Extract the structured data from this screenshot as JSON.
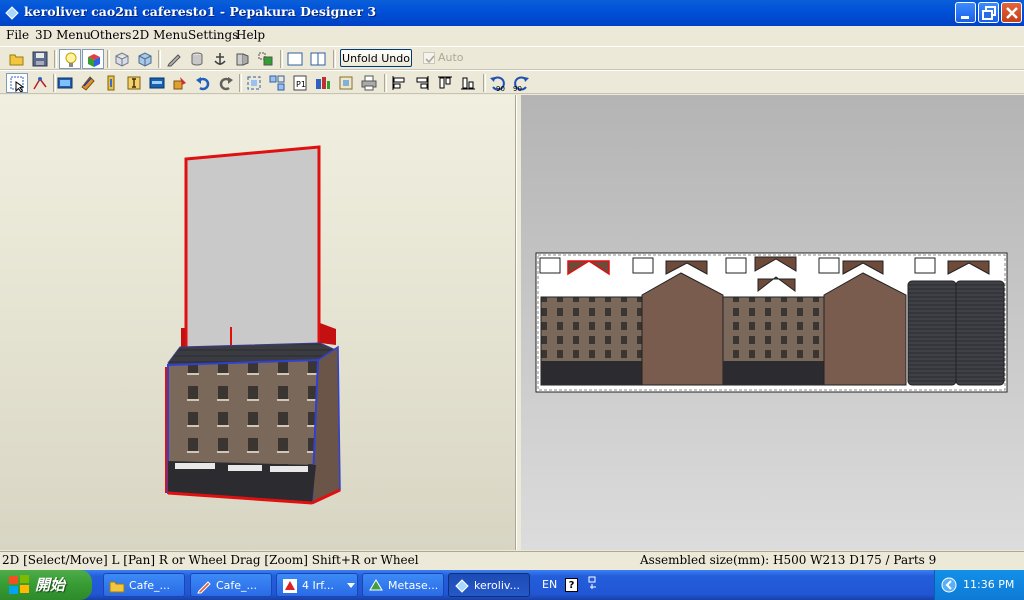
{
  "window": {
    "title": "keroliver cao2ni caferesto1 - Pepakura Designer 3",
    "controls": [
      "minimize-icon",
      "restore-icon",
      "close-icon"
    ]
  },
  "menu": [
    "File",
    "3D Menu",
    "Others",
    "2D Menu",
    "Settings",
    "Help"
  ],
  "toolbar1": {
    "icons": [
      "open-folder-icon",
      "save-icon",
      "lightbulb-icon",
      "color-cube-icon",
      "cube-icon",
      "textured-cube-icon",
      "pencil-icon",
      "cylinder-icon",
      "anchor-icon",
      "flap-icon",
      "join-icon",
      "single-view-icon",
      "dual-view-icon"
    ],
    "unfold_undo_label": "Unfold Undo",
    "auto_label": "Auto"
  },
  "toolbar2": {
    "icons": [
      "select-move-icon",
      "edit-edges-icon",
      "film-icon",
      "join-faces-icon",
      "flap-toggle-icon",
      "text-icon",
      "image-icon",
      "rotate-part-icon",
      "undo-arrow-icon",
      "redo-arrow-icon",
      "fit-view-icon",
      "arrange-icon",
      "page-icon",
      "layout-icon",
      "texture-icon",
      "print-icon",
      "align-left-icon",
      "align-right-icon",
      "align-top-icon",
      "align-bottom-icon",
      "rotate-ccw-90-icon",
      "rotate-cw-90-icon"
    ],
    "rotate_labels": [
      "90",
      "90"
    ]
  },
  "status": {
    "left": "2D [Select/Move] L [Pan] R or Wheel Drag [Zoom] Shift+R or Wheel",
    "right": "Assembled size(mm): H500  W213  D175 / Parts 9"
  },
  "taskbar": {
    "start_label": "開始",
    "tasks": [
      {
        "label": "Cafe_...",
        "icon": "folder-icon",
        "active": false
      },
      {
        "label": "Cafe_...",
        "icon": "pencil-icon",
        "active": false
      },
      {
        "label": "4  Irf...",
        "icon": "irfanview-icon",
        "active": false
      },
      {
        "label": "Metase...",
        "icon": "metasequoia-icon",
        "active": false
      },
      {
        "label": "keroliv...",
        "icon": "pepakura-icon",
        "active": true
      }
    ],
    "language": "EN",
    "clock": "11:36 PM"
  },
  "colors": {
    "title_bar": "#0054e3",
    "accent_red": "#e01010",
    "edge_blue": "#3040d0",
    "viewport_3d_bg": "#f1f0e0",
    "viewport_2d_bg": "#c8c8c8"
  }
}
